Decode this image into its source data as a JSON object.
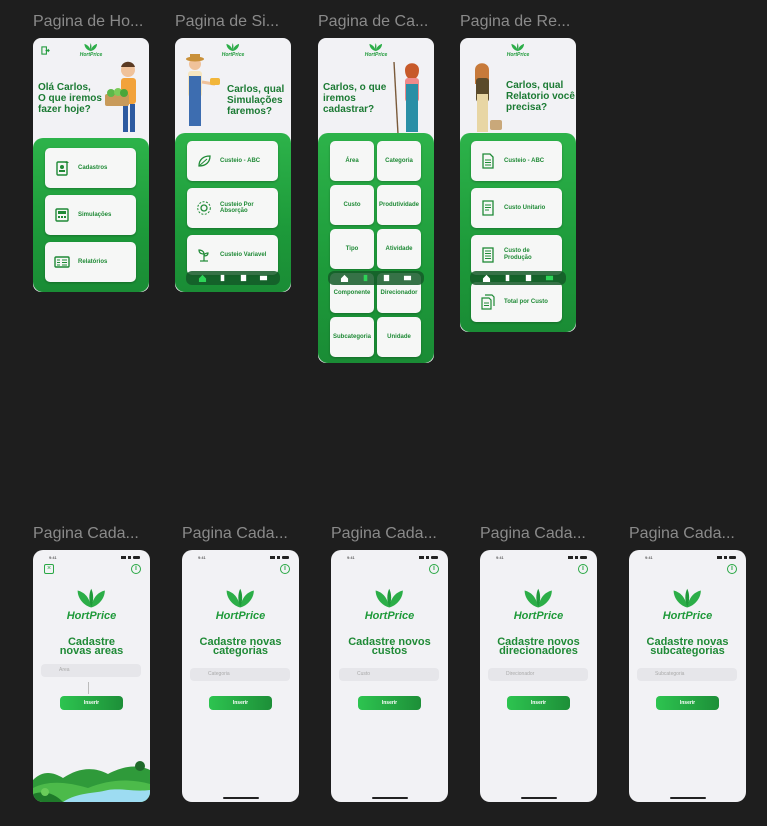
{
  "frames": [
    {
      "title": "Pagina de Ho..."
    },
    {
      "title": "Pagina de Si..."
    },
    {
      "title": "Pagina de Ca..."
    },
    {
      "title": "Pagina de Re..."
    },
    {
      "title": "Pagina Cada..."
    },
    {
      "title": "Pagina Cada..."
    },
    {
      "title": "Pagina Cada..."
    },
    {
      "title": "Pagina Cada..."
    },
    {
      "title": "Pagina Cada..."
    }
  ],
  "brand": {
    "name": "HortPrice",
    "color": "#1f9a3a"
  },
  "home": {
    "greeting_lines": [
      "Olá Carlos,",
      "O que iremos",
      "fazer hoje?"
    ],
    "items": [
      {
        "label": "Cadastros",
        "icon": "id-card-icon"
      },
      {
        "label": "Simulações",
        "icon": "calculator-icon"
      },
      {
        "label": "Relatórios",
        "icon": "report-icon"
      }
    ]
  },
  "simulations": {
    "greeting_lines": [
      "Carlos, qual",
      "Simulações",
      "faremos?"
    ],
    "items": [
      {
        "label": "Custeio - ABC",
        "icon": "leaf-icon"
      },
      {
        "label": "Custeio Por Absorção",
        "icon": "sun-icon"
      },
      {
        "label": "Custeio Variavel",
        "icon": "sprout-icon"
      }
    ]
  },
  "register": {
    "greeting_lines": [
      "Carlos, o que",
      "iremos",
      "cadastrar?"
    ],
    "items": [
      "Área",
      "Categoria",
      "Custo",
      "Produtividade",
      "Tipo",
      "Atividade",
      "Componente",
      "Direcionador",
      "Subcategoria",
      "Unidade"
    ]
  },
  "reports": {
    "greeting_lines": [
      "Carlos, qual",
      "Relatorio você",
      "precisa?"
    ],
    "items": [
      {
        "label": "Custeio - ABC",
        "icon": "document-icon"
      },
      {
        "label": "Custo Unitario",
        "icon": "document-icon"
      },
      {
        "label": "Custo de Produção",
        "icon": "document-icon"
      },
      {
        "label": "Total por Custo",
        "icon": "documents-icon"
      }
    ]
  },
  "status_bar": {
    "time": "9:41"
  },
  "forms": [
    {
      "title_lines": [
        "Cadastre",
        "novas areas"
      ],
      "placeholder": "Area",
      "button": "Inserir"
    },
    {
      "title_lines": [
        "Cadastre novas",
        "categorias"
      ],
      "placeholder": "Categoria",
      "button": "Inserir"
    },
    {
      "title_lines": [
        "Cadastre novos",
        "custos"
      ],
      "placeholder": "Custo",
      "button": "Inserir"
    },
    {
      "title_lines": [
        "Cadastre novos",
        "direcionadores"
      ],
      "placeholder": "Direcionador",
      "button": "Inserir"
    },
    {
      "title_lines": [
        "Cadastre novas",
        "subcategorias"
      ],
      "placeholder": "Subcategoria",
      "button": "Inserir"
    }
  ],
  "colors": {
    "accent": "#1f9a3a",
    "panel": "#22a240",
    "background": "#1e1e1e",
    "screen": "#f2f2f5"
  }
}
